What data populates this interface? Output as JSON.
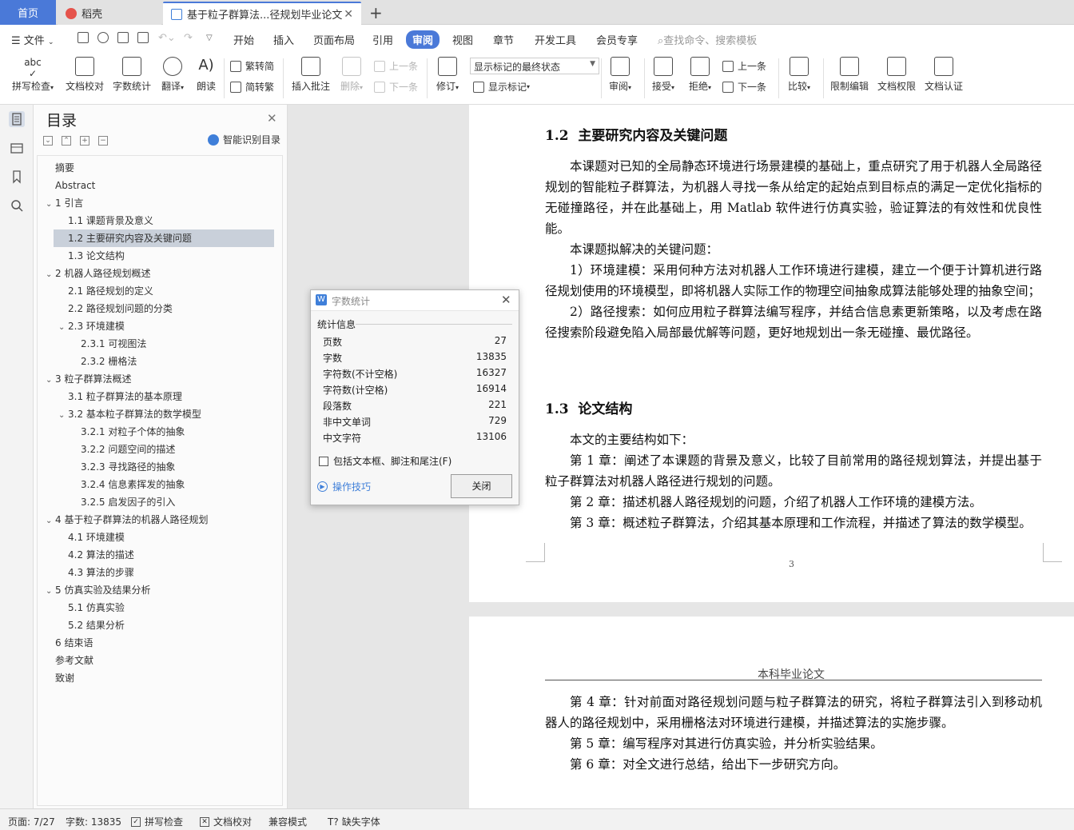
{
  "tabs": {
    "home": "首页",
    "daoke": "稻壳",
    "document": "基于粒子群算法...径规划毕业论文",
    "new_tab": "+"
  },
  "menu": {
    "file": "文件",
    "items": [
      "开始",
      "插入",
      "页面布局",
      "引用",
      "审阅",
      "视图",
      "章节",
      "开发工具",
      "会员专享"
    ],
    "active": "审阅",
    "search_placeholder": "查找命令、搜索模板"
  },
  "ribbon": {
    "spellcheck": "拼写检查",
    "doc_proof": "文档校对",
    "word_count": "字数统计",
    "translate": "翻译",
    "read_aloud": "朗读",
    "trad_to_simp": "繁转简",
    "simp_to_trad": "简转繁",
    "insert_comment": "插入批注",
    "delete": "删除",
    "prev_comment": "上一条",
    "next_comment": "下一条",
    "revise": "修订",
    "markup_select": "显示标记的最终状态",
    "show_markup": "显示标记",
    "review": "审阅",
    "accept": "接受",
    "reject": "拒绝",
    "prev_change": "上一条",
    "next_change": "下一条",
    "compare": "比较",
    "restrict_edit": "限制编辑",
    "doc_permission": "文档权限",
    "doc_cert": "文档认证"
  },
  "toc": {
    "title": "目录",
    "smart": "智能识别目录",
    "items": [
      {
        "label": "摘要",
        "level": 0,
        "caret": ""
      },
      {
        "label": "Abstract",
        "level": 0,
        "caret": ""
      },
      {
        "label": "1  引言",
        "level": 0,
        "caret": "v"
      },
      {
        "label": "1.1  课题背景及意义",
        "level": 1,
        "caret": ""
      },
      {
        "label": "1.2  主要研究内容及关键问题",
        "level": 1,
        "caret": "",
        "selected": true
      },
      {
        "label": "1.3  论文结构",
        "level": 1,
        "caret": ""
      },
      {
        "label": "2  机器人路径规划概述",
        "level": 0,
        "caret": "v"
      },
      {
        "label": "2.1  路径规划的定义",
        "level": 1,
        "caret": ""
      },
      {
        "label": "2.2  路径规划问题的分类",
        "level": 1,
        "caret": ""
      },
      {
        "label": "2.3  环境建模",
        "level": 1,
        "caret": "v"
      },
      {
        "label": "2.3.1  可视图法",
        "level": 2,
        "caret": ""
      },
      {
        "label": "2.3.2  栅格法",
        "level": 2,
        "caret": ""
      },
      {
        "label": "3  粒子群算法概述",
        "level": 0,
        "caret": "v"
      },
      {
        "label": "3.1  粒子群算法的基本原理",
        "level": 1,
        "caret": ""
      },
      {
        "label": "3.2  基本粒子群算法的数学模型",
        "level": 1,
        "caret": "v"
      },
      {
        "label": "3.2.1  对粒子个体的抽象",
        "level": 2,
        "caret": ""
      },
      {
        "label": "3.2.2  问题空间的描述",
        "level": 2,
        "caret": ""
      },
      {
        "label": "3.2.3  寻找路径的抽象",
        "level": 2,
        "caret": ""
      },
      {
        "label": "3.2.4  信息素挥发的抽象",
        "level": 2,
        "caret": ""
      },
      {
        "label": "3.2.5  启发因子的引入",
        "level": 2,
        "caret": ""
      },
      {
        "label": "4  基于粒子群算法的机器人路径规划",
        "level": 0,
        "caret": "v"
      },
      {
        "label": "4.1  环境建模",
        "level": 1,
        "caret": ""
      },
      {
        "label": "4.2  算法的描述",
        "level": 1,
        "caret": ""
      },
      {
        "label": "4.3  算法的步骤",
        "level": 1,
        "caret": ""
      },
      {
        "label": "5  仿真实验及结果分析",
        "level": 0,
        "caret": "v"
      },
      {
        "label": "5.1  仿真实验",
        "level": 1,
        "caret": ""
      },
      {
        "label": "5.2  结果分析",
        "level": 1,
        "caret": ""
      },
      {
        "label": "6  结束语",
        "level": 0,
        "caret": ""
      },
      {
        "label": "参考文献",
        "level": 0,
        "caret": ""
      },
      {
        "label": "致谢",
        "level": 0,
        "caret": ""
      }
    ]
  },
  "doc": {
    "h12_num": "1.2",
    "h12_text": "主要研究内容及关键问题",
    "p1": "本课题对已知的全局静态环境进行场景建模的基础上，重点研究了用于机器人全局路径规划的智能粒子群算法，为机器人寻找一条从给定的起始点到目标点的满足一定优化指标的无碰撞路径，并在此基础上，用 Matlab 软件进行仿真实验，验证算法的有效性和优良性能。",
    "p2": "本课题拟解决的关键问题：",
    "p3": "1）环境建模：采用何种方法对机器人工作环境进行建模，建立一个便于计算机进行路径规划使用的环境模型，即将机器人实际工作的物理空间抽象成算法能够处理的抽象空间；",
    "p4": "2）路径搜索：如何应用粒子群算法编写程序，并结合信息素更新策略，以及考虑在路径搜索阶段避免陷入局部最优解等问题，更好地规划出一条无碰撞、最优路径。",
    "h13_num": "1.3",
    "h13_text": "论文结构",
    "p5": "本文的主要结构如下：",
    "p6": "第 1 章：阐述了本课题的背景及意义，比较了目前常用的路径规划算法，并提出基于粒子群算法对机器人路径进行规划的问题。",
    "p7": "第 2 章：描述机器人路径规划的问题，介绍了机器人工作环境的建模方法。",
    "p8": "第 3 章：概述粒子群算法，介绍其基本原理和工作流程，并描述了算法的数学模型。",
    "page_number": "3",
    "header2": "本科毕业论文",
    "p9": "第 4 章：针对前面对路径规划问题与粒子群算法的研究，将粒子群算法引入到移动机器人的路径规划中，采用栅格法对环境进行建模，并描述算法的实施步骤。",
    "p10": "第 5 章：编写程序对其进行仿真实验，并分析实验结果。",
    "p11": "第 6 章：对全文进行总结，给出下一步研究方向。"
  },
  "dialog": {
    "title": "字数统计",
    "section": "统计信息",
    "rows": [
      {
        "label": "页数",
        "value": "27"
      },
      {
        "label": "字数",
        "value": "13835"
      },
      {
        "label": "字符数(不计空格)",
        "value": "16327"
      },
      {
        "label": "字符数(计空格)",
        "value": "16914"
      },
      {
        "label": "段落数",
        "value": "221"
      },
      {
        "label": "非中文单词",
        "value": "729"
      },
      {
        "label": "中文字符",
        "value": "13106"
      }
    ],
    "include_check": "包括文本框、脚注和尾注(F)",
    "tips": "操作技巧",
    "close": "关闭"
  },
  "status": {
    "page": "页面: 7/27",
    "words": "字数: 13835",
    "spellcheck": "拼写检查",
    "proof": "文档校对",
    "compat": "兼容模式",
    "missing_font": "缺失字体"
  },
  "colors": {
    "accent": "#4a79d8",
    "toc_selected": "#c9d0da"
  }
}
